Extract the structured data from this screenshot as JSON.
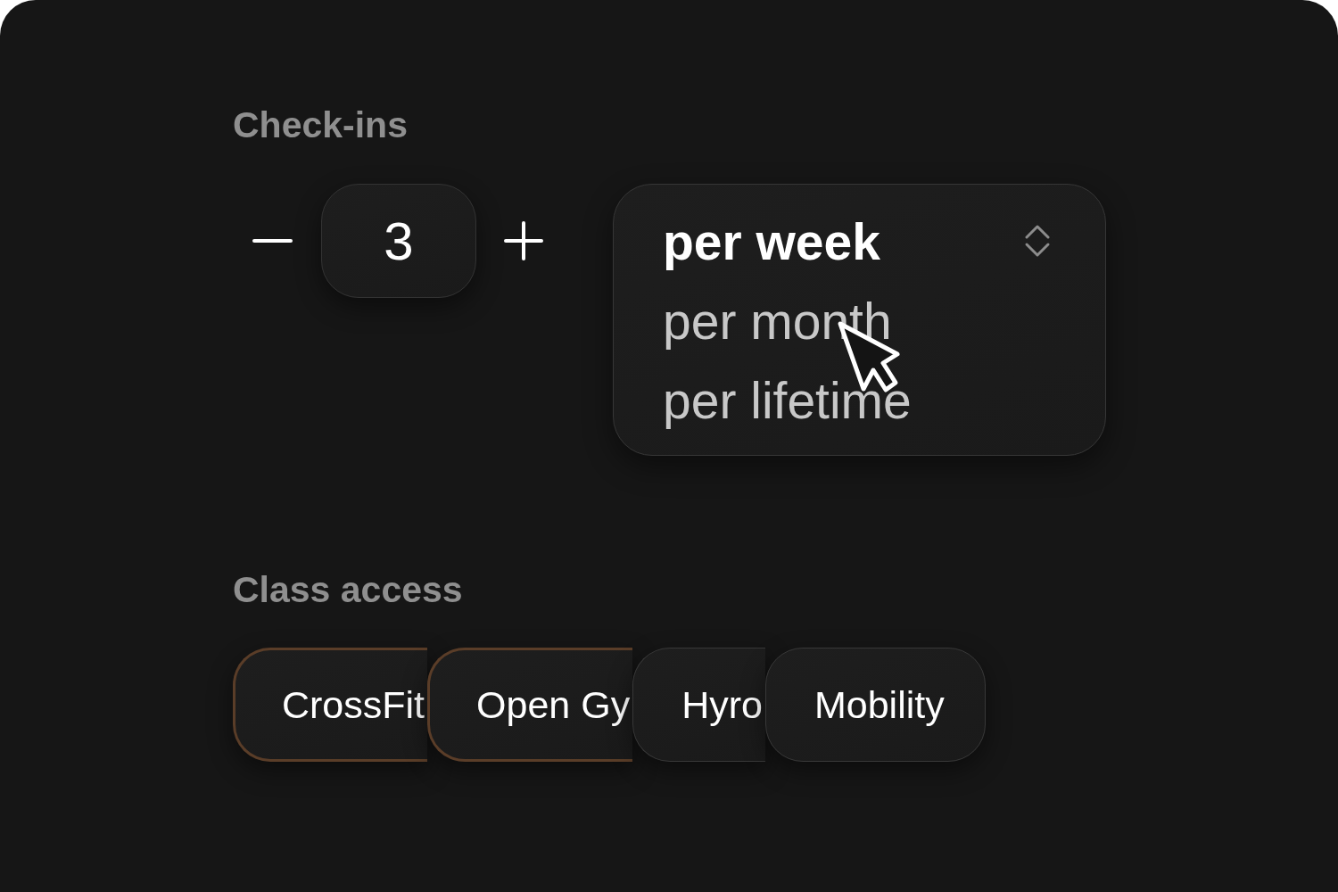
{
  "checkins": {
    "label": "Check-ins",
    "value": "3"
  },
  "period_dropdown": {
    "options": [
      {
        "label": "per week",
        "selected": true
      },
      {
        "label": "per month",
        "selected": false
      },
      {
        "label": "per lifetime",
        "selected": false
      }
    ]
  },
  "class_access": {
    "label": "Class access",
    "chips": [
      {
        "label": "CrossFit",
        "selected": true
      },
      {
        "label": "Open Gy",
        "selected": true
      },
      {
        "label": "Hyro",
        "selected": false
      },
      {
        "label": "Mobility",
        "selected": false
      }
    ]
  }
}
